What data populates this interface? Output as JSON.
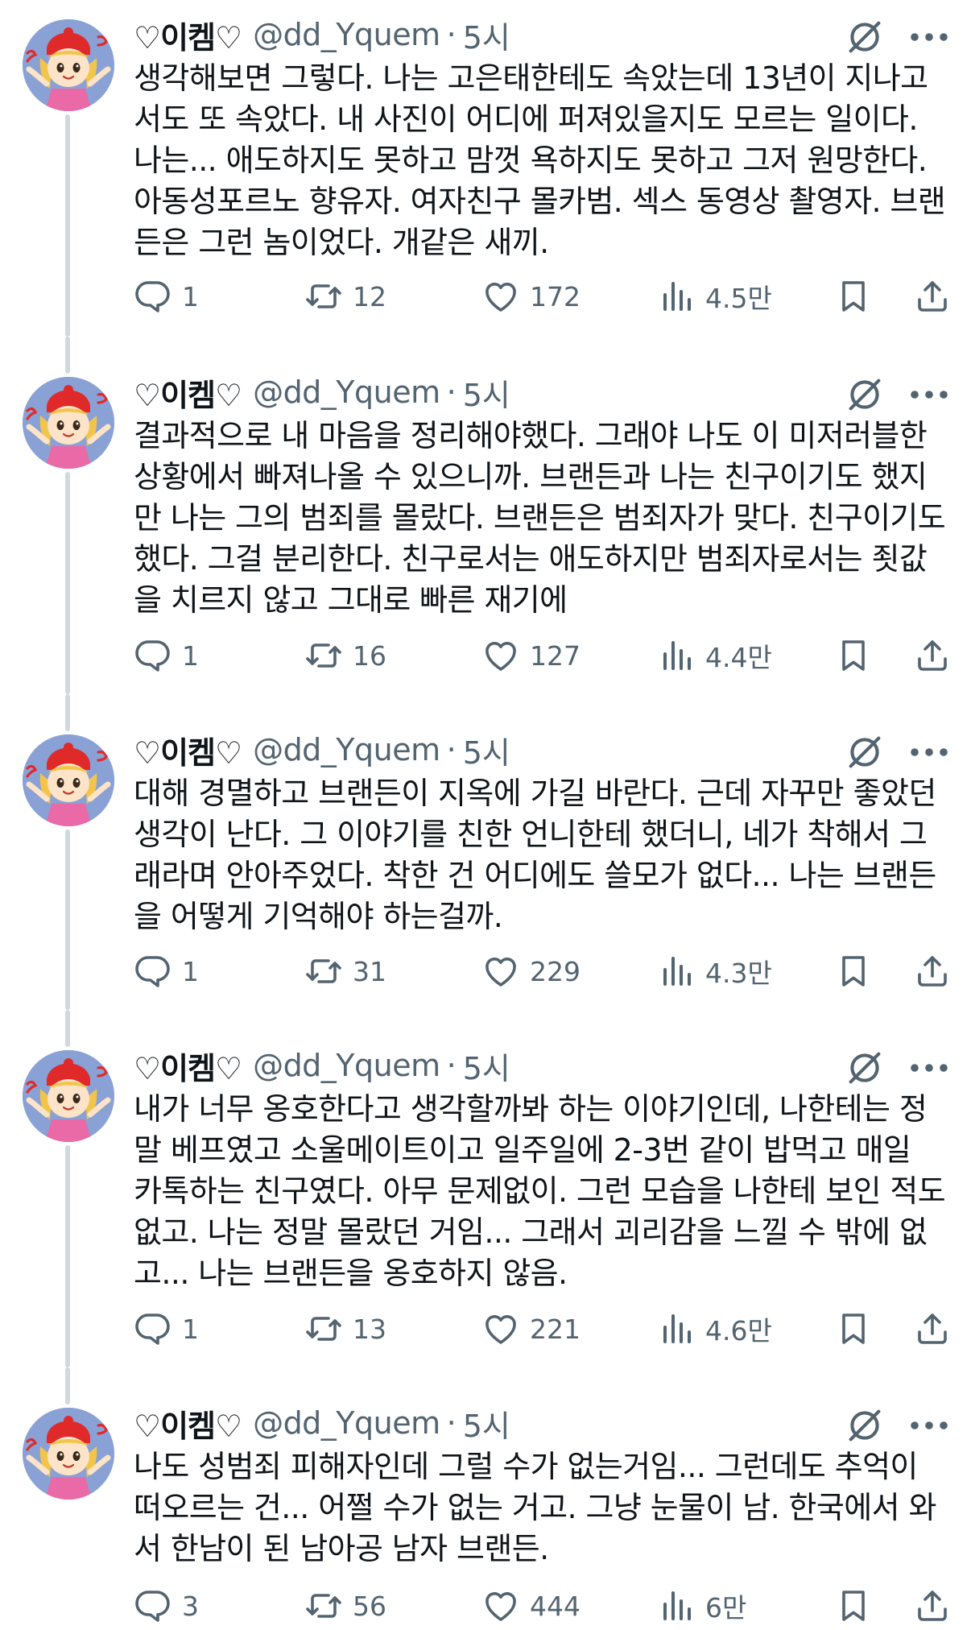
{
  "tweets": [
    {
      "name": "♡이켐♡",
      "handle": "@dd_Yquem",
      "time": "5시",
      "lines": [
        "생각해보면 그렇다. 나는 고은태한테도 속았는데 13년이 지나고",
        "서도 또 속았다. 내 사진이 어디에 퍼져있을지도 모르는 일이다.",
        "나는... 애도하지도 못하고 맘껏 욕하지도 못하고 그저 원망한다.",
        "아동성포르노 향유자. 여자친구 몰카범. 섹스 동영상 촬영자. 브랜",
        "든은 그런 놈이었다. 개같은 새끼."
      ],
      "replies": "1",
      "retweets": "12",
      "likes": "172",
      "views": "4.5만"
    },
    {
      "name": "♡이켐♡",
      "handle": "@dd_Yquem",
      "time": "5시",
      "lines": [
        "결과적으로 내 마음을 정리해야했다. 그래야 나도 이 미저러블한",
        "상황에서 빠져나올 수 있으니까. 브랜든과 나는 친구이기도 했지",
        "만 나는 그의 범죄를 몰랐다. 브랜든은 범죄자가 맞다. 친구이기도",
        "했다. 그걸 분리한다. 친구로서는 애도하지만 범죄자로서는 죗값",
        "을 치르지 않고 그대로 빠른 재기에"
      ],
      "replies": "1",
      "retweets": "16",
      "likes": "127",
      "views": "4.4만"
    },
    {
      "name": "♡이켐♡",
      "handle": "@dd_Yquem",
      "time": "5시",
      "lines": [
        "대해 경멸하고 브랜든이 지옥에 가길 바란다. 근데 자꾸만 좋았던",
        "생각이 난다. 그 이야기를 친한 언니한테 했더니, 네가 착해서 그",
        "래라며 안아주었다. 착한 건 어디에도 쓸모가 없다... 나는 브랜든",
        "을 어떻게 기억해야 하는걸까."
      ],
      "replies": "1",
      "retweets": "31",
      "likes": "229",
      "views": "4.3만"
    },
    {
      "name": "♡이켐♡",
      "handle": "@dd_Yquem",
      "time": "5시",
      "lines": [
        "내가 너무 옹호한다고 생각할까봐 하는 이야기인데, 나한테는 정",
        "말 베프였고 소울메이트이고 일주일에 2-3번 같이 밥먹고 매일",
        "카톡하는 친구였다. 아무 문제없이. 그런 모습을 나한테 보인 적도",
        "없고. 나는 정말 몰랐던 거임... 그래서 괴리감을 느낄 수 밖에 없",
        "고... 나는 브랜든을 옹호하지 않음."
      ],
      "replies": "1",
      "retweets": "13",
      "likes": "221",
      "views": "4.6만"
    },
    {
      "name": "♡이켐♡",
      "handle": "@dd_Yquem",
      "time": "5시",
      "lines": [
        "나도 성범죄 피해자인데 그럴 수가 없는거임... 그런데도 추억이",
        "떠오르는 건... 어쩔 수가 없는 거고. 그냥 눈물이 남. 한국에서 와",
        "서 한남이 된 남아공 남자 브랜든."
      ],
      "replies": "3",
      "retweets": "56",
      "likes": "444",
      "views": "6만"
    }
  ],
  "icons": {
    "reply": "reply-icon",
    "retweet": "retweet-icon",
    "like": "like-icon",
    "views": "views-icon",
    "bookmark": "bookmark-icon",
    "share": "share-icon",
    "grok": "grok-icon",
    "more": "more-icon"
  },
  "colors": {
    "text": "#0f1419",
    "secondary": "#536471",
    "connector": "#cfd9de",
    "avatar_bg": "#8aa1d6"
  }
}
